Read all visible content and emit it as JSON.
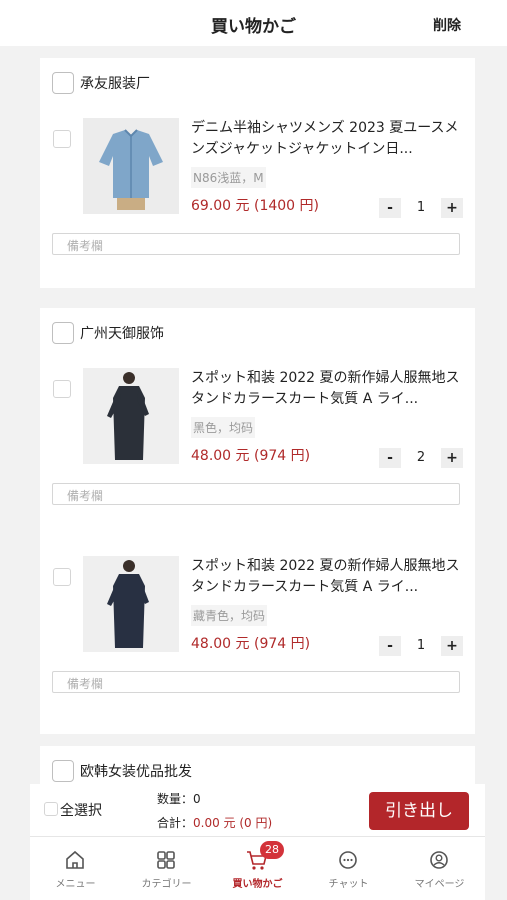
{
  "header": {
    "title": "買い物かご",
    "delete_label": "削除"
  },
  "shops": [
    {
      "name": "承友服装厂",
      "items": [
        {
          "title": "デニム半袖シャツメンズ 2023 夏ユースメンズジャケットジャケットイン日...",
          "variant": "N86浅蓝，M",
          "price": "69.00 元 (1400 円)",
          "quantity": "1",
          "memo_placeholder": "備考欄",
          "image": "denim-shirt"
        }
      ]
    },
    {
      "name": "广州天御服饰",
      "items": [
        {
          "title": "スポット和装 2022 夏の新作婦人服無地スタンドカラースカート気質 A ライ...",
          "variant": "黑色，均码",
          "price": "48.00 元 (974 円)",
          "quantity": "2",
          "memo_placeholder": "備考欄",
          "image": "black-dress"
        },
        {
          "title": "スポット和装 2022 夏の新作婦人服無地スタンドカラースカート気質 A ライ...",
          "variant": "藏青色，均码",
          "price": "48.00 元 (974 円)",
          "quantity": "1",
          "memo_placeholder": "備考欄",
          "image": "navy-dress"
        }
      ]
    },
    {
      "name": "欧韩女装优品批发",
      "items": []
    }
  ],
  "qty_minus": "-",
  "qty_plus": "+",
  "footer": {
    "select_all": "全選択",
    "count_label": "数量：",
    "count_value": "0",
    "total_label": "合計：",
    "total_value": "0.00 元 (0 円)",
    "checkout": "引き出し"
  },
  "tabbar": {
    "tabs": [
      {
        "label": "メニュー",
        "icon": "home-icon"
      },
      {
        "label": "カテゴリー",
        "icon": "grid-icon"
      },
      {
        "label": "買い物かご",
        "icon": "cart-icon",
        "badge": "28",
        "active": true
      },
      {
        "label": "チャット",
        "icon": "chat-icon"
      },
      {
        "label": "マイページ",
        "icon": "user-icon"
      }
    ]
  },
  "colors": {
    "accent": "#b3262a",
    "price": "#b02a2a",
    "badge": "#d3333a"
  }
}
